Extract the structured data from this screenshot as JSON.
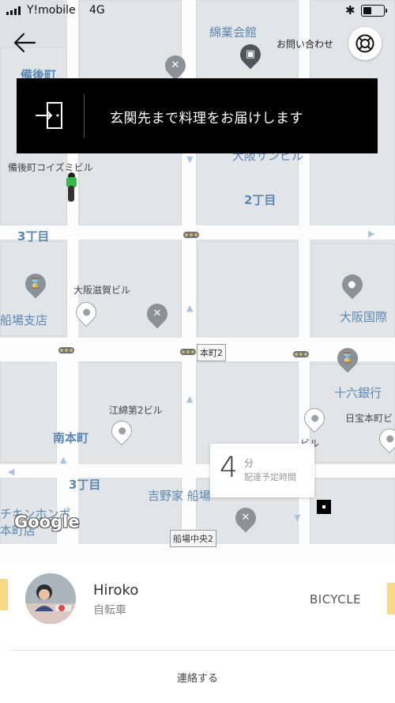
{
  "status_bar": {
    "carrier": "Y!mobile",
    "network": "4G",
    "battery_level": 0.45
  },
  "header": {
    "contact_label": "お問い合わせ"
  },
  "instruction_banner": {
    "text": "玄関先まで料理をお届けします"
  },
  "map": {
    "labels": {
      "bingomachi": "備後町",
      "menkyo_kaikan": "綿業会館",
      "bingomachi_koizumi": "備後町コイズミビル",
      "osaka_sun_building": "大阪サンビル",
      "nichome": "2丁目",
      "sanchome_upper": "3丁目",
      "shigaginko": "大阪滋賀ビル",
      "funaba_branch": "船場支店",
      "osaka_kokusai": "大阪国際",
      "honmachi2": "本町2",
      "juroku_bank": "十六銀行",
      "etsumen2": "江綿第2ビル",
      "nippo_honmachi": "日宝本町ビ",
      "minamihonmachi": "南本町",
      "sanchome_lower": "3丁目",
      "building_sign": "ビル",
      "yoshinoya": "吉野家 船場",
      "chicken_shop": "チキンホンポ",
      "honmachi_shop": "本町店",
      "funaba_chuo2": "船場中央2"
    },
    "google_logo": "Google"
  },
  "eta": {
    "minutes": "4",
    "unit": "分",
    "label": "配達予定時間"
  },
  "courier": {
    "name": "Hiroko",
    "vehicle": "自転車",
    "vehicle_type": "BICYCLE"
  },
  "actions": {
    "contact_label": "連絡する"
  },
  "colors": {
    "road": "#fdfdfd",
    "block": "#e2e5e8",
    "district_text": "#5a87b3",
    "banner": "#000000",
    "rider_bag": "#39b54a"
  },
  "icons": {
    "back": "arrow-left-icon",
    "help": "lifebuoy-icon",
    "door": "door-enter-icon",
    "restaurant": "fork-knife-icon",
    "bank": "bank-icon",
    "destination": "destination-square-icon",
    "rider": "bicycle-rider-icon"
  }
}
